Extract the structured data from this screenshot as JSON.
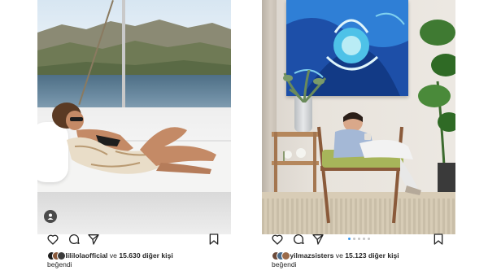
{
  "posts": [
    {
      "liker_username": "lililolaofficial",
      "likes_connector": "ve",
      "likes_count": "15.630",
      "likes_suffix": "diğer kişi",
      "likes_line2": "beğendi",
      "has_carousel": false
    },
    {
      "liker_username": "yilmazsisters",
      "likes_connector": "ve",
      "likes_count": "15.123",
      "likes_suffix": "diğer kişi",
      "likes_line2": "beğendi",
      "has_carousel": true,
      "carousel_total": 5,
      "carousel_active": 1
    }
  ],
  "icons": {
    "like": "heart-icon",
    "comment": "comment-icon",
    "share": "share-icon",
    "save": "bookmark-icon",
    "tagged_user": "user-icon"
  },
  "colors": {
    "text": "#262626",
    "carousel_active": "#3897f0",
    "carousel_inactive": "#c4c4c4"
  }
}
